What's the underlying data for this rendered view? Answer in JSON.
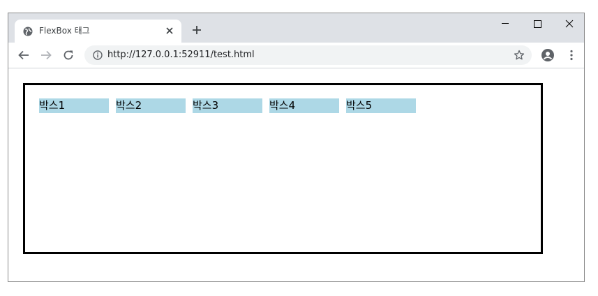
{
  "browser": {
    "tab": {
      "title": "FlexBox 태그",
      "favicon": "globe-icon"
    },
    "window_controls": [
      "minimize-icon",
      "maximize-icon",
      "close-icon"
    ],
    "toolbar": {
      "back": "back-arrow-icon",
      "forward": "forward-arrow-icon",
      "reload": "reload-icon",
      "url": "http://127.0.0.1:52911/test.html",
      "bookmark": "star-icon",
      "profile": "profile-icon",
      "menu": "kebab-menu-icon"
    }
  },
  "page": {
    "boxes": [
      {
        "label": "박스1"
      },
      {
        "label": "박스2"
      },
      {
        "label": "박스3"
      },
      {
        "label": "박스4"
      },
      {
        "label": "박스5"
      }
    ]
  },
  "colors": {
    "box_background": "#add8e6",
    "container_border": "#000000",
    "titlebar": "#dee1e6",
    "omnibox": "#f1f3f4"
  }
}
